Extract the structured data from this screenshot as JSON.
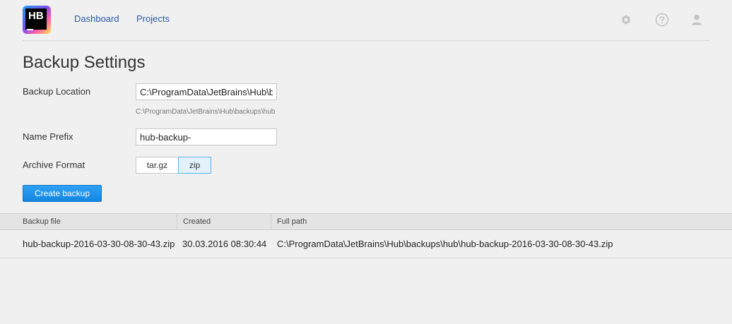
{
  "app": {
    "logo_text": "HB"
  },
  "nav": {
    "dashboard": "Dashboard",
    "projects": "Projects"
  },
  "header_icons": [
    "settings-icon",
    "help-icon",
    "user-icon"
  ],
  "page": {
    "title": "Backup Settings"
  },
  "form": {
    "backup_location": {
      "label": "Backup Location",
      "value": "C:\\ProgramData\\JetBrains\\Hub\\backups\\hub",
      "hint": "C:\\ProgramData\\JetBrains\\Hub\\backups\\hub"
    },
    "name_prefix": {
      "label": "Name Prefix",
      "value": "hub-backup-"
    },
    "archive_format": {
      "label": "Archive Format",
      "options": [
        "tar.gz",
        "zip"
      ],
      "selected": "zip"
    },
    "create_button": "Create backup"
  },
  "backups_table": {
    "columns": [
      "Backup file",
      "Created",
      "Full path"
    ],
    "rows": [
      {
        "file": "hub-backup-2016-03-30-08-30-43.zip",
        "created": "30.03.2016 08:30:44",
        "path": "C:\\ProgramData\\JetBrains\\Hub\\backups\\hub\\hub-backup-2016-03-30-08-30-43.zip"
      }
    ]
  },
  "colors": {
    "background": "#f0f0f0",
    "link": "#2a5aa8",
    "primary": "#1386e0",
    "selected_segment": "#e2f1fb"
  }
}
